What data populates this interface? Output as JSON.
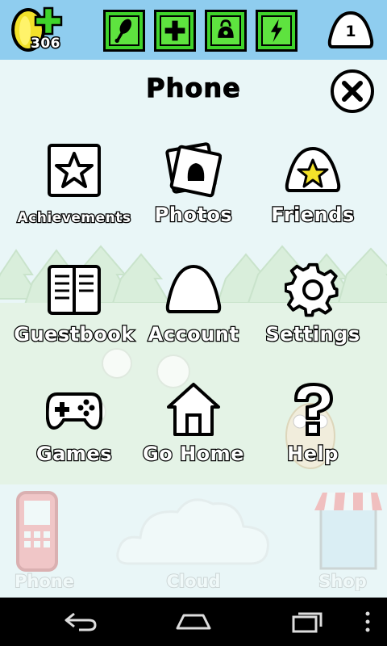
{
  "header": {
    "coins": "306",
    "level": "1",
    "stats": [
      {
        "name": "hunger-stat",
        "icon": "drumstick-icon"
      },
      {
        "name": "health-stat",
        "icon": "cross-icon"
      },
      {
        "name": "hygiene-stat",
        "icon": "soap-icon"
      },
      {
        "name": "energy-stat",
        "icon": "lightning-icon"
      }
    ],
    "accent": "#3fd42b"
  },
  "panel": {
    "title": "Phone",
    "items": [
      {
        "label": "Achievements",
        "icon": "star-box-icon"
      },
      {
        "label": "Photos",
        "icon": "photos-icon"
      },
      {
        "label": "Friends",
        "icon": "friends-star-icon"
      },
      {
        "label": "Guestbook",
        "icon": "book-icon"
      },
      {
        "label": "Account",
        "icon": "pou-icon"
      },
      {
        "label": "Settings",
        "icon": "gear-icon"
      },
      {
        "label": "Games",
        "icon": "gamepad-icon"
      },
      {
        "label": "Go Home",
        "icon": "house-icon"
      },
      {
        "label": "Help",
        "icon": "question-icon"
      }
    ]
  },
  "bottom_bar": {
    "left": "Phone",
    "center": "Cloud",
    "right": "Shop"
  },
  "system_nav": {
    "back": "back-icon",
    "home": "home-icon",
    "recents": "recents-icon",
    "menu": "menu-icon"
  }
}
